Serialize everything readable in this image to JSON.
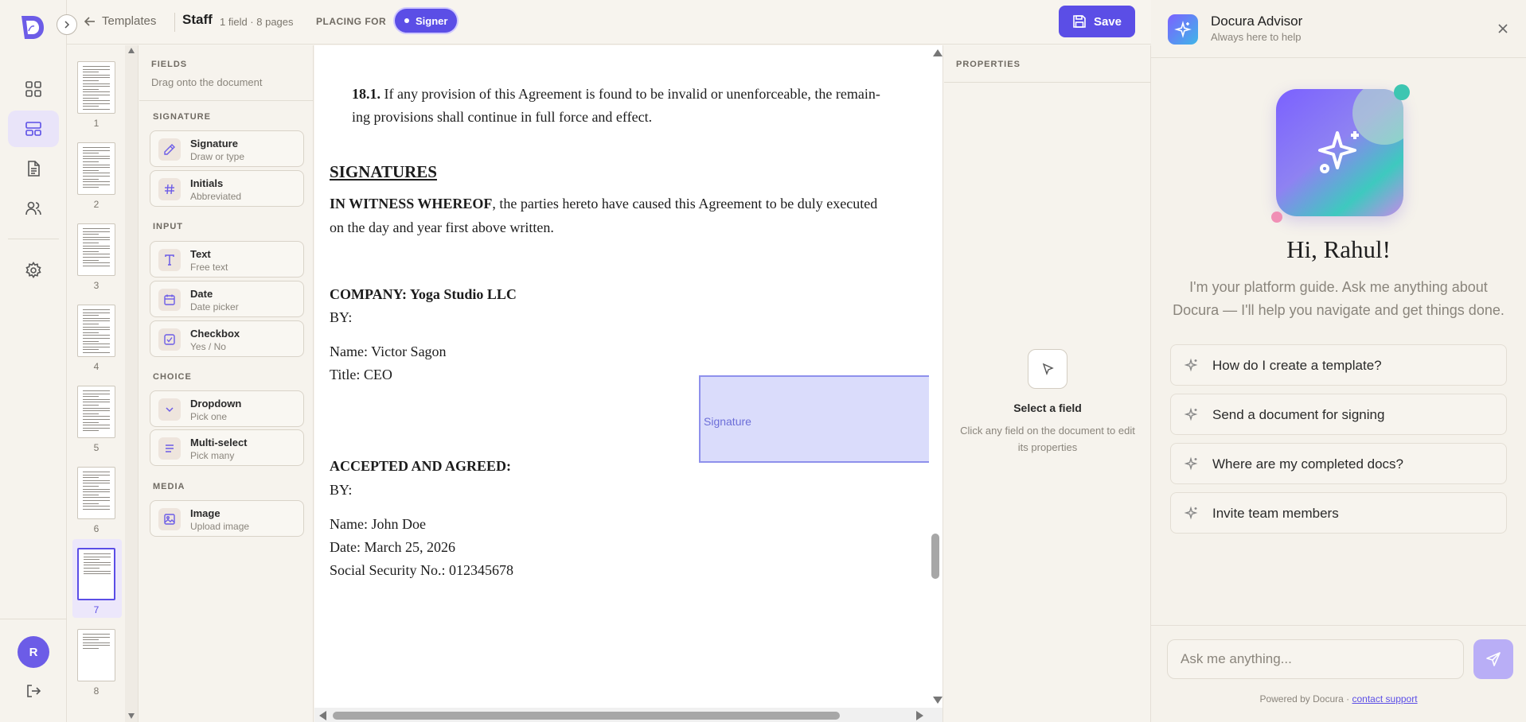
{
  "header": {
    "back_label": "Templates",
    "doc_title": "Staff",
    "doc_meta": "1 field · 8 pages",
    "placing_label": "PLACING FOR",
    "signer_label": "Signer",
    "save_label": "Save"
  },
  "user": {
    "initial": "R"
  },
  "thumbnails": {
    "pages": [
      "1",
      "2",
      "3",
      "4",
      "5",
      "6",
      "7",
      "8"
    ],
    "active_page": "7"
  },
  "fields_panel": {
    "title": "FIELDS",
    "subtitle": "Drag onto the document",
    "sections": {
      "signature": "SIGNATURE",
      "input": "INPUT",
      "choice": "CHOICE",
      "media": "MEDIA"
    },
    "items": {
      "signature": {
        "name": "Signature",
        "desc": "Draw or type"
      },
      "initials": {
        "name": "Initials",
        "desc": "Abbreviated"
      },
      "text": {
        "name": "Text",
        "desc": "Free text"
      },
      "date": {
        "name": "Date",
        "desc": "Date picker"
      },
      "checkbox": {
        "name": "Checkbox",
        "desc": "Yes / No"
      },
      "dropdown": {
        "name": "Dropdown",
        "desc": "Pick one"
      },
      "multiselect": {
        "name": "Multi-select",
        "desc": "Pick many"
      },
      "image": {
        "name": "Image",
        "desc": "Upload image"
      }
    }
  },
  "document": {
    "clause_num": "18.1.",
    "clause_text_1": " If any provision of this Agreement is found to be invalid or unenforceable, the remain-",
    "clause_text_2": "ing provisions shall continue in full force and effect.",
    "signatures_heading": "SIGNATURES",
    "witness_bold": "IN WITNESS WHEREOF",
    "witness_rest_1": ", the parties hereto have caused this Agreement to be duly executed",
    "witness_rest_2": "on the day and year first above written.",
    "company_line": "COMPANY: Yoga Studio LLC",
    "by_1": "BY:",
    "company_name": "Name: Victor Sagon",
    "company_title": "Title: CEO",
    "accepted_heading": "ACCEPTED AND AGREED:",
    "by_2": "BY:",
    "signer_name": "Name: John Doe",
    "signer_date": "Date: March 25, 2026",
    "signer_ssn": "Social Security No.: 012345678",
    "placed_field_label": "Signature"
  },
  "properties": {
    "title": "PROPERTIES",
    "empty_title": "Select a field",
    "empty_sub": "Click any field on the document to edit its properties"
  },
  "advisor": {
    "name": "Docura Advisor",
    "tagline": "Always here to help",
    "greeting": "Hi, Rahul!",
    "intro": "I'm your platform guide. Ask me anything about Docura — I'll help you navigate and get things done.",
    "suggestions": [
      "How do I create a template?",
      "Send a document for signing",
      "Where are my completed docs?",
      "Invite team members"
    ],
    "input_placeholder": "Ask me anything...",
    "powered_by": "Powered by Docura · ",
    "support_link": "contact support"
  },
  "colors": {
    "accent": "#5b4ee6",
    "field_fill": "#dadcfb",
    "field_border": "#8e90ec"
  }
}
